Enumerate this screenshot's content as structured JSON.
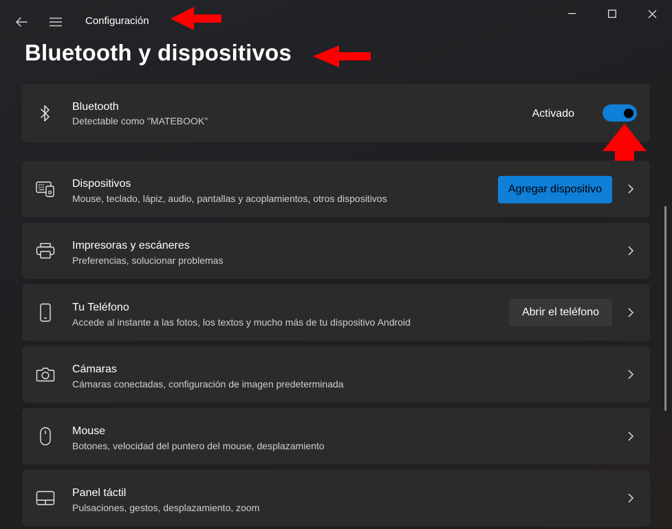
{
  "window": {
    "title": "Configuración",
    "page_title": "Bluetooth y dispositivos"
  },
  "colors": {
    "accent": "#0f7fd8",
    "card_bg": "#2b2b2b",
    "annotation_arrow": "#ff0000"
  },
  "bluetooth": {
    "icon": "bluetooth-icon",
    "title": "Bluetooth",
    "subtitle": "Detectable como \"MATEBOOK\"",
    "state_label": "Activado",
    "enabled": true
  },
  "items": [
    {
      "icon": "keyboard-devices-icon",
      "title": "Dispositivos",
      "subtitle": "Mouse, teclado, lápiz, audio, pantallas y acoplamientos, otros dispositivos",
      "button_label": "Agregar dispositivo"
    },
    {
      "icon": "printer-icon",
      "title": "Impresoras y escáneres",
      "subtitle": "Preferencias, solucionar problemas"
    },
    {
      "icon": "phone-icon",
      "title": "Tu Teléfono",
      "subtitle": "Accede al instante a las fotos, los textos y mucho más de tu dispositivo Android",
      "button_label": "Abrir el teléfono"
    },
    {
      "icon": "camera-icon",
      "title": "Cámaras",
      "subtitle": "Cámaras conectadas, configuración de imagen predeterminada"
    },
    {
      "icon": "mouse-icon",
      "title": "Mouse",
      "subtitle": "Botones, velocidad del puntero del mouse, desplazamiento"
    },
    {
      "icon": "touchpad-icon",
      "title": "Panel táctil",
      "subtitle": "Pulsaciones, gestos, desplazamiento, zoom"
    }
  ]
}
